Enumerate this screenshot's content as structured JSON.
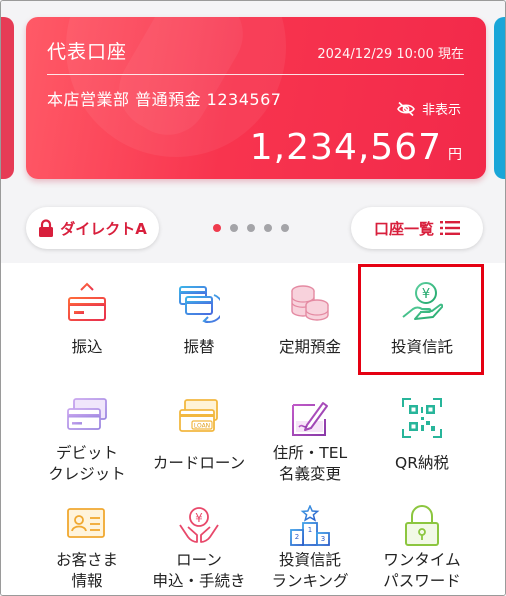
{
  "card": {
    "title": "代表口座",
    "timestamp": "2024/12/29 10:00 現在",
    "account": "本店営業部 普通預金 1234567",
    "hide_label": "非表示",
    "amount": "1,234,567",
    "currency": "円"
  },
  "pills": {
    "direct": "ダイレクトA",
    "account_list": "口座一覧"
  },
  "carousel": {
    "count": 5,
    "active_index": 0
  },
  "colors": {
    "brand_red": "#d81f3c",
    "card_red": "#f8344e",
    "highlight": "#e50012"
  },
  "menu": [
    {
      "lines": [
        "振込"
      ],
      "icon": "transfer-icon"
    },
    {
      "lines": [
        "振替"
      ],
      "icon": "account-transfer-icon"
    },
    {
      "lines": [
        "定期預金"
      ],
      "icon": "coins-icon"
    },
    {
      "lines": [
        "投資信託"
      ],
      "icon": "investment-icon"
    },
    {
      "lines": [
        "デビット",
        "クレジット"
      ],
      "icon": "cards-icon"
    },
    {
      "lines": [
        "カードローン"
      ],
      "icon": "loan-card-icon"
    },
    {
      "lines": [
        "住所・TEL",
        "名義変更"
      ],
      "icon": "edit-form-icon"
    },
    {
      "lines": [
        "QR納税"
      ],
      "icon": "qr-code-icon"
    },
    {
      "lines": [
        "お客さま",
        "情報"
      ],
      "icon": "customer-id-icon"
    },
    {
      "lines": [
        "ローン",
        "申込・手続き"
      ],
      "icon": "loan-hands-icon"
    },
    {
      "lines": [
        "投資信託",
        "ランキング"
      ],
      "icon": "ranking-icon"
    },
    {
      "lines": [
        "ワンタイム",
        "パスワード"
      ],
      "icon": "padlock-icon"
    }
  ]
}
